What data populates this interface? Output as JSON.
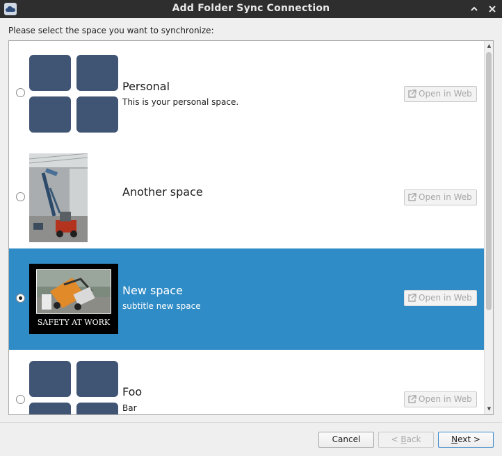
{
  "window": {
    "title": "Add Folder Sync Connection"
  },
  "prompt": "Please select the space you want to synchronize:",
  "spaces": [
    {
      "name": "Personal",
      "subtitle": "This is your personal space.",
      "image": "placeholder-tiles-icon",
      "selected": false,
      "open_web_label": "Open in Web"
    },
    {
      "name": "Another space",
      "subtitle": "",
      "image": "forklift-photo",
      "selected": false,
      "open_web_label": "Open in Web"
    },
    {
      "name": "New space",
      "subtitle": "subtitle new space",
      "image": "safety-at-work-poster",
      "image_caption": "SAFETY AT WORK",
      "selected": true,
      "open_web_label": "Open in Web"
    },
    {
      "name": "Foo",
      "subtitle": "Bar",
      "image": "placeholder-tiles-icon",
      "selected": false,
      "open_web_label": "Open in Web"
    }
  ],
  "buttons": {
    "cancel": "Cancel",
    "back_mnemonic": "B",
    "back_rest": "ack",
    "back_prefix": "< ",
    "next_mnemonic": "N",
    "next_rest": "ext >"
  },
  "colors": {
    "selection": "#308cc6",
    "tile": "#405474",
    "titlebar": "#2e2e2e"
  }
}
